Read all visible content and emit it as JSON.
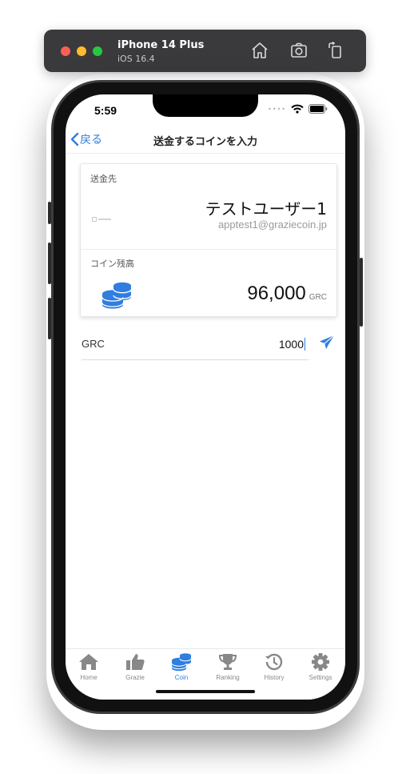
{
  "simulator": {
    "device_name": "iPhone 14 Plus",
    "os_version": "iOS 16.4",
    "icons": [
      "home-icon",
      "screenshot-icon",
      "rotate-icon"
    ]
  },
  "status_bar": {
    "time": "5:59"
  },
  "nav": {
    "back_label": "戻る",
    "title": "送金するコインを入力"
  },
  "recipient": {
    "section_label": "送金先",
    "name": "テストユーザー1",
    "email": "apptest1@graziecoin.jp"
  },
  "balance": {
    "section_label": "コイン残高",
    "value": "96,000",
    "unit": "GRC"
  },
  "amount": {
    "label": "GRC",
    "value": "1000"
  },
  "tabs": [
    {
      "label": "Home",
      "icon": "home-icon",
      "active": false
    },
    {
      "label": "Grazie",
      "icon": "thumbs-up-icon",
      "active": false
    },
    {
      "label": "Coin",
      "icon": "coins-icon",
      "active": true
    },
    {
      "label": "Ranking",
      "icon": "trophy-icon",
      "active": false
    },
    {
      "label": "History",
      "icon": "history-icon",
      "active": false
    },
    {
      "label": "Settings",
      "icon": "gear-icon",
      "active": false
    }
  ],
  "colors": {
    "accent": "#2f7ee0",
    "inactive": "#888888"
  }
}
